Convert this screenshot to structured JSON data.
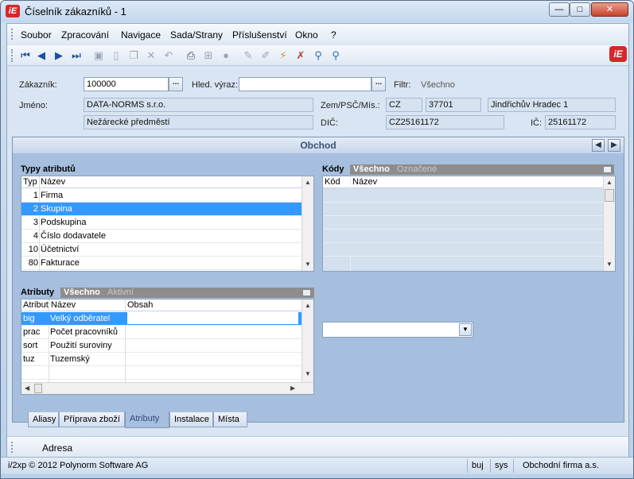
{
  "window": {
    "title": "Číselník zákazníků - 1",
    "logo": "iE",
    "close": "✕",
    "min": "▭",
    "max": "□"
  },
  "menu": [
    "Soubor",
    "Zpracování",
    "Navigace",
    "Sada/Strany",
    "Příslušenství",
    "Okno",
    "?"
  ],
  "toolbar_icons": [
    "first-record-icon",
    "prev-record-icon",
    "next-record-icon",
    "last-record-icon",
    "save-icon",
    "new-icon",
    "copy-icon",
    "delete-icon",
    "undo-icon",
    "print-icon",
    "tree-icon",
    "disabled-icon",
    "edit-icon",
    "edit-alt-icon",
    "filter-icon",
    "filter-clear-icon",
    "search-icon",
    "search-advanced-icon"
  ],
  "brand": "iE",
  "form": {
    "zakaznik_label": "Zákazník:",
    "zakaznik_value": "100000",
    "hled_label": "Hled. výraz:",
    "hled_value": "",
    "filtr_label": "Filtr:",
    "filtr_value": "Všechno",
    "jmeno_label": "Jméno:",
    "jmeno_value": "DATA-NORMS s.r.o.",
    "jmeno2_value": "Nežárecké předměstí",
    "zem_label": "Zem/PSČ/Mís.:",
    "zem_value": "CZ",
    "psc_value": "37701",
    "mesto_value": "Jindřichův Hradec 1",
    "dic_label": "DIČ:",
    "dic_value": "CZ25161172",
    "ic_label": "IČ:",
    "ic_value": "25161172",
    "dots": "..."
  },
  "panel": {
    "title": "Obchod",
    "typy_title": "Typy atributů",
    "typy_headers": [
      "Typ",
      "Název"
    ],
    "typy_rows": [
      {
        "typ": "1",
        "nazev": "Firma"
      },
      {
        "typ": "2",
        "nazev": "Skupina"
      },
      {
        "typ": "3",
        "nazev": "Podskupina"
      },
      {
        "typ": "4",
        "nazev": "Číslo dodavatele"
      },
      {
        "typ": "10",
        "nazev": "Účetnictví"
      },
      {
        "typ": "80",
        "nazev": "Fakturace"
      }
    ],
    "kody_title": "Kódy",
    "kody_seg_on": "Všechno",
    "kody_seg_off": "Označené",
    "kody_headers": [
      "Kód",
      "Název"
    ],
    "atributy_title": "Atributy",
    "atr_seg_on": "Všechno",
    "atr_seg_off": "Aktivní",
    "atr_headers": [
      "Atribut",
      "Název",
      "Obsah"
    ],
    "atr_rows": [
      {
        "atribut": "big",
        "nazev": "Velký odběratel",
        "obsah": ""
      },
      {
        "atribut": "prac",
        "nazev": "Počet pracovníků",
        "obsah": ""
      },
      {
        "atribut": "sort",
        "nazev": "Použití suroviny",
        "obsah": ""
      },
      {
        "atribut": "tuz",
        "nazev": "Tuzemský",
        "obsah": ""
      }
    ]
  },
  "tabs": [
    "Aliasy",
    "Příprava zboží",
    "Atributy",
    "Instalace",
    "Místa"
  ],
  "address": "Adresa",
  "status": {
    "copyright": "i/2xp © 2012 Polynorm Software AG",
    "user": "buj",
    "db": "sys",
    "company": "Obchodní firma a.s."
  }
}
